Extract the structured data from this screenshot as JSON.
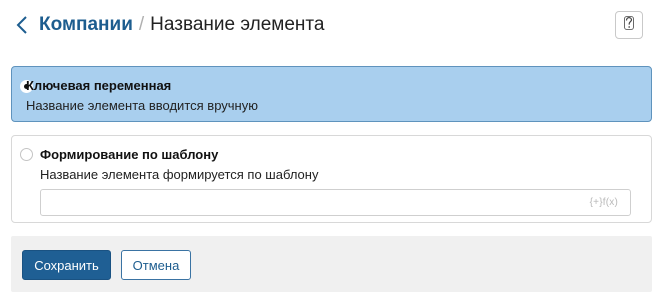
{
  "header": {
    "back_icon": "chevron-left-icon",
    "breadcrumb_parent": "Компании",
    "separator": "/",
    "title": "Название элемента",
    "help_icon": "question-icon"
  },
  "options": [
    {
      "title": "Ключевая переменная",
      "description": "Название элемента вводится вручную",
      "selected": true
    },
    {
      "title": "Формирование по шаблону",
      "description": "Название элемента формируется по шаблону",
      "selected": false,
      "input_value": "",
      "input_badge": "{+}f(x)"
    }
  ],
  "footer": {
    "save_label": "Сохранить",
    "cancel_label": "Отмена"
  },
  "colors": {
    "accent": "#1f5f94",
    "link": "#1d5d8f",
    "selected_bg": "#a9cfee",
    "selected_border": "#5f93bd",
    "footer_bg": "#f0f0f0"
  }
}
